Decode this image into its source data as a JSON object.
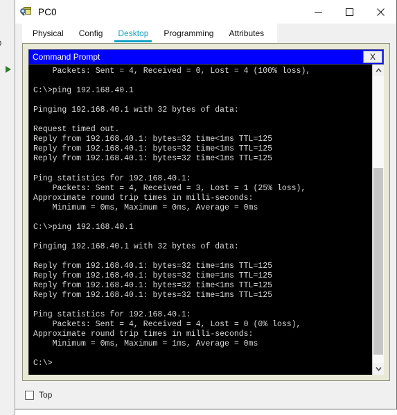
{
  "background_app": {
    "edge_label": "0",
    "marker_icon": "green-triangle-icon"
  },
  "window": {
    "title": "PC0",
    "icon": "pc-magnifier-icon",
    "controls": {
      "minimize": "minimize-icon",
      "maximize": "maximize-icon",
      "close": "close-icon"
    }
  },
  "tabs": [
    {
      "label": "Physical",
      "active": false
    },
    {
      "label": "Config",
      "active": false
    },
    {
      "label": "Desktop",
      "active": true
    },
    {
      "label": "Programming",
      "active": false
    },
    {
      "label": "Attributes",
      "active": false
    }
  ],
  "colors": {
    "accent_tab": "#14a3c7",
    "cmd_titlebar": "#0000FF",
    "panel_beige": "#e9e9d8",
    "terminal_bg": "#000000",
    "terminal_fg": "#d8d8d8"
  },
  "command_prompt": {
    "title": "Command Prompt",
    "close_label": "X",
    "scrollbar": {
      "up_arrow": "chevron-up-icon",
      "down_arrow": "chevron-down-icon",
      "thumb_position_percent": 68
    },
    "lines": [
      "    Packets: Sent = 4, Received = 0, Lost = 4 (100% loss),",
      "",
      "C:\\>ping 192.168.40.1",
      "",
      "Pinging 192.168.40.1 with 32 bytes of data:",
      "",
      "Request timed out.",
      "Reply from 192.168.40.1: bytes=32 time<1ms TTL=125",
      "Reply from 192.168.40.1: bytes=32 time<1ms TTL=125",
      "Reply from 192.168.40.1: bytes=32 time<1ms TTL=125",
      "",
      "Ping statistics for 192.168.40.1:",
      "    Packets: Sent = 4, Received = 3, Lost = 1 (25% loss),",
      "Approximate round trip times in milli-seconds:",
      "    Minimum = 0ms, Maximum = 0ms, Average = 0ms",
      "",
      "C:\\>ping 192.168.40.1",
      "",
      "Pinging 192.168.40.1 with 32 bytes of data:",
      "",
      "Reply from 192.168.40.1: bytes=32 time=1ms TTL=125",
      "Reply from 192.168.40.1: bytes=32 time=1ms TTL=125",
      "Reply from 192.168.40.1: bytes=32 time<1ms TTL=125",
      "Reply from 192.168.40.1: bytes=32 time=1ms TTL=125",
      "",
      "Ping statistics for 192.168.40.1:",
      "    Packets: Sent = 4, Received = 4, Lost = 0 (0% loss),",
      "Approximate round trip times in milli-seconds:",
      "    Minimum = 0ms, Maximum = 1ms, Average = 0ms",
      "",
      "C:\\>"
    ]
  },
  "bottom_bar": {
    "top_checkbox_label": "Top",
    "top_checkbox_checked": false
  }
}
